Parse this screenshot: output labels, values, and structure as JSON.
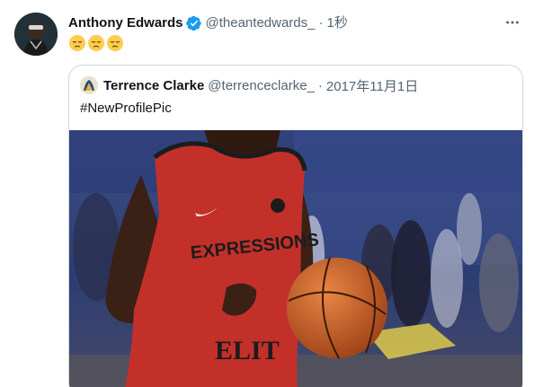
{
  "tweet": {
    "author": {
      "display_name": "Anthony Edwards",
      "handle": "@theantedwards_",
      "verified": true
    },
    "separator": "·",
    "time": "1秒",
    "emojis": [
      "pensive-face",
      "pensive-face",
      "pensive-face"
    ],
    "colors": {
      "verified": "#1d9bf0",
      "secondary_text": "#536471",
      "emoji": "#ffcc4d"
    }
  },
  "quote": {
    "author": {
      "display_name": "Terrence Clarke",
      "handle": "@terrenceclarke_"
    },
    "separator": "·",
    "time": "2017年11月1日",
    "text": "#NewProfilePic",
    "media": {
      "jersey_text_top": "EXPRESSIONS",
      "jersey_text_bottom": "ELIT"
    }
  },
  "icons": {
    "more": "more-horizontal-icon",
    "verified": "verified-badge-icon"
  }
}
